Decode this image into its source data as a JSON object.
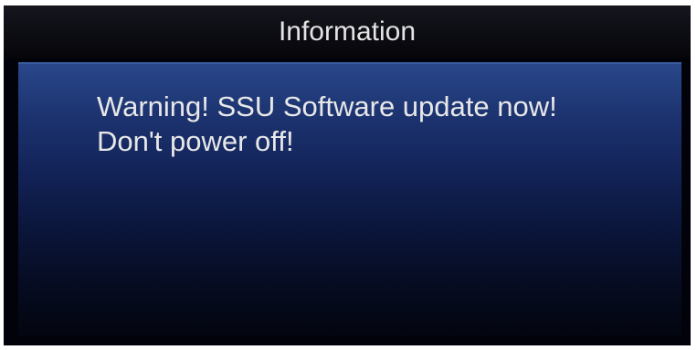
{
  "dialog": {
    "title": "Information",
    "message_lines": [
      "Warning! SSU Software update now!",
      "Don't power off!"
    ]
  },
  "colors": {
    "title_bar": "#0a0a10",
    "body_gradient_top": "#29478a",
    "body_gradient_bottom": "#03060f",
    "text": "#e8e8e8"
  }
}
